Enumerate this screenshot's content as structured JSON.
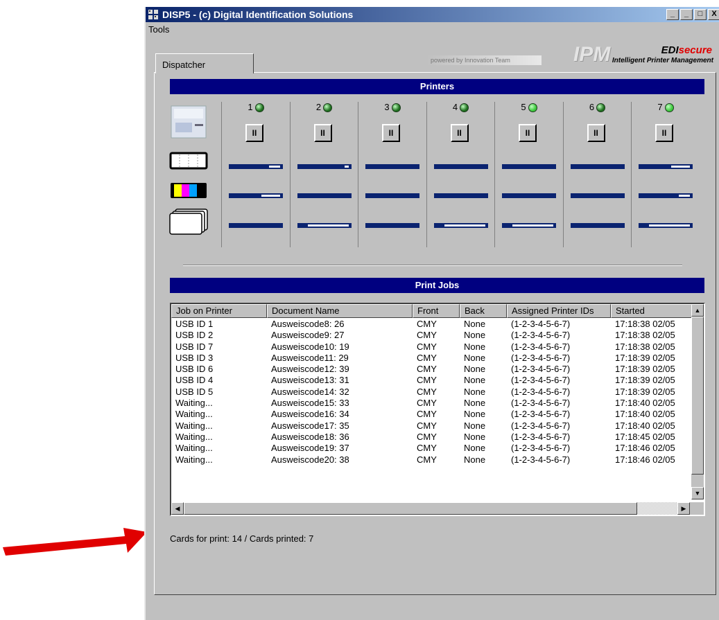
{
  "window": {
    "title": "DISP5 - (c) Digital Identification Solutions",
    "buttons": [
      "_",
      "_",
      "□",
      "X"
    ]
  },
  "menu": {
    "items": [
      "Tools"
    ]
  },
  "tabs": [
    {
      "label": "Dispatcher",
      "selected": true
    }
  ],
  "branding": {
    "powered_by": "powered by Innovation Team",
    "logo": "IPM",
    "edi_prefix": "EDI",
    "edi_suffix": "secure",
    "subtitle": "Intelligent Printer Management"
  },
  "printers": {
    "header": "Printers",
    "row_icons": [
      "printer-icon",
      "ribbon-icon",
      "color-ribbon-icon",
      "cards-stack-icon"
    ],
    "items": [
      {
        "number": "1",
        "status_color": "#1f6f1f",
        "pause_label": "II",
        "levels": [
          0.2,
          0.35,
          0.0
        ]
      },
      {
        "number": "2",
        "status_color": "#1f6f1f",
        "pause_label": "II",
        "levels": [
          0.08,
          0.0,
          0.75
        ]
      },
      {
        "number": "3",
        "status_color": "#1f6f1f",
        "pause_label": "II",
        "levels": [
          0.0,
          0.0,
          0.0
        ]
      },
      {
        "number": "4",
        "status_color": "#1f6f1f",
        "pause_label": "II",
        "levels": [
          0.0,
          0.0,
          0.75
        ]
      },
      {
        "number": "5",
        "status_color": "#3cc83c",
        "pause_label": "II",
        "levels": [
          0.0,
          0.0,
          0.75
        ]
      },
      {
        "number": "6",
        "status_color": "#1f6f1f",
        "pause_label": "II",
        "levels": [
          0.0,
          0.0,
          0.0
        ]
      },
      {
        "number": "7",
        "status_color": "#3cc83c",
        "pause_label": "II",
        "levels": [
          0.35,
          0.2,
          0.75
        ]
      }
    ]
  },
  "print_jobs": {
    "header": "Print Jobs",
    "columns": [
      "Job on Printer",
      "Document Name",
      "Front",
      "Back",
      "Assigned Printer IDs",
      "Started"
    ],
    "rows": [
      [
        "USB ID 1",
        "Ausweiscode8: 26",
        "CMY",
        "None",
        "(1-2-3-4-5-6-7)",
        "17:18:38 02/05"
      ],
      [
        "USB ID 2",
        "Ausweiscode9: 27",
        "CMY",
        "None",
        "(1-2-3-4-5-6-7)",
        "17:18:38 02/05"
      ],
      [
        "USB ID 7",
        "Ausweiscode10: 19",
        "CMY",
        "None",
        "(1-2-3-4-5-6-7)",
        "17:18:38 02/05"
      ],
      [
        "USB ID 3",
        "Ausweiscode11: 29",
        "CMY",
        "None",
        "(1-2-3-4-5-6-7)",
        "17:18:39 02/05"
      ],
      [
        "USB ID 6",
        "Ausweiscode12: 39",
        "CMY",
        "None",
        "(1-2-3-4-5-6-7)",
        "17:18:39 02/05"
      ],
      [
        "USB ID 4",
        "Ausweiscode13: 31",
        "CMY",
        "None",
        "(1-2-3-4-5-6-7)",
        "17:18:39 02/05"
      ],
      [
        "USB ID 5",
        "Ausweiscode14: 32",
        "CMY",
        "None",
        "(1-2-3-4-5-6-7)",
        "17:18:39 02/05"
      ],
      [
        "Waiting...",
        "Ausweiscode15: 33",
        "CMY",
        "None",
        "(1-2-3-4-5-6-7)",
        "17:18:40 02/05"
      ],
      [
        "Waiting...",
        "Ausweiscode16: 34",
        "CMY",
        "None",
        "(1-2-3-4-5-6-7)",
        "17:18:40 02/05"
      ],
      [
        "Waiting...",
        "Ausweiscode17: 35",
        "CMY",
        "None",
        "(1-2-3-4-5-6-7)",
        "17:18:40 02/05"
      ],
      [
        "Waiting...",
        "Ausweiscode18: 36",
        "CMY",
        "None",
        "(1-2-3-4-5-6-7)",
        "17:18:45 02/05"
      ],
      [
        "Waiting...",
        "Ausweiscode19: 37",
        "CMY",
        "None",
        "(1-2-3-4-5-6-7)",
        "17:18:46 02/05"
      ],
      [
        "Waiting...",
        "Ausweiscode20: 38",
        "CMY",
        "None",
        "(1-2-3-4-5-6-7)",
        "17:18:46 02/05"
      ]
    ]
  },
  "status": {
    "text": "Cards for print: 14 / Cards printed: 7"
  },
  "annotation": {
    "arrow_color": "#e00000"
  }
}
